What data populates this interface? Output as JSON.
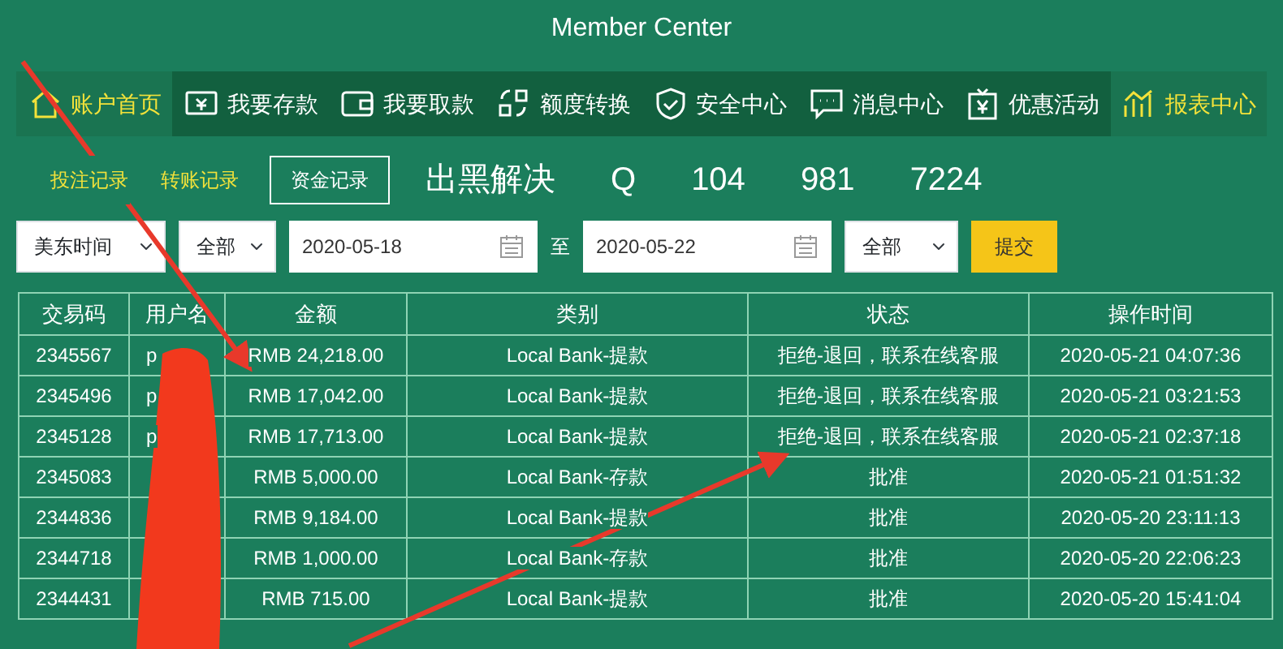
{
  "header": {
    "subtitle": "Member Center"
  },
  "nav": [
    {
      "label": "账户首页",
      "kind": "home",
      "selected": true
    },
    {
      "label": "我要存款",
      "kind": "deposit",
      "selected": false
    },
    {
      "label": "我要取款",
      "kind": "wallet",
      "selected": false
    },
    {
      "label": "额度转换",
      "kind": "transfer",
      "selected": false
    },
    {
      "label": "安全中心",
      "kind": "shield",
      "selected": false
    },
    {
      "label": "消息中心",
      "kind": "message",
      "selected": false
    },
    {
      "label": "优惠活动",
      "kind": "promo",
      "selected": false
    },
    {
      "label": "报表中心",
      "kind": "chart",
      "selected": true
    }
  ],
  "sub_tabs": [
    {
      "label": "投注记录",
      "selected": false
    },
    {
      "label": "转账记录",
      "selected": false
    },
    {
      "label": "资金记录",
      "selected": true
    }
  ],
  "contact_banner": [
    "出黑解决",
    "Q",
    "104",
    "981",
    "7224"
  ],
  "filters": {
    "timezone": "美东时间",
    "type": "全部",
    "date_from": "2020-05-18",
    "separator": "至",
    "date_to": "2020-05-22",
    "status": "全部",
    "submit": "提交"
  },
  "table": {
    "columns": [
      "交易码",
      "用户名",
      "金额",
      "类别",
      "状态",
      "操作时间"
    ],
    "rows": [
      [
        "2345567",
        "p",
        "RMB 24,218.00",
        "Local Bank-提款",
        "拒绝-退回，联系在线客服",
        "2020-05-21 04:07:36"
      ],
      [
        "2345496",
        "p",
        "RMB 17,042.00",
        "Local Bank-提款",
        "拒绝-退回，联系在线客服",
        "2020-05-21 03:21:53"
      ],
      [
        "2345128",
        "p",
        "RMB 17,713.00",
        "Local Bank-提款",
        "拒绝-退回，联系在线客服",
        "2020-05-21 02:37:18"
      ],
      [
        "2345083",
        "",
        "RMB 5,000.00",
        "Local Bank-存款",
        "批准",
        "2020-05-21 01:51:32"
      ],
      [
        "2344836",
        "",
        "RMB 9,184.00",
        "Local Bank-提款",
        "批准",
        "2020-05-20 23:11:13"
      ],
      [
        "2344718",
        "",
        "RMB 1,000.00",
        "Local Bank-存款",
        "批准",
        "2020-05-20 22:06:23"
      ],
      [
        "2344431",
        "",
        "RMB 715.00",
        "Local Bank-提款",
        "批准",
        "2020-05-20 15:41:04"
      ]
    ]
  }
}
